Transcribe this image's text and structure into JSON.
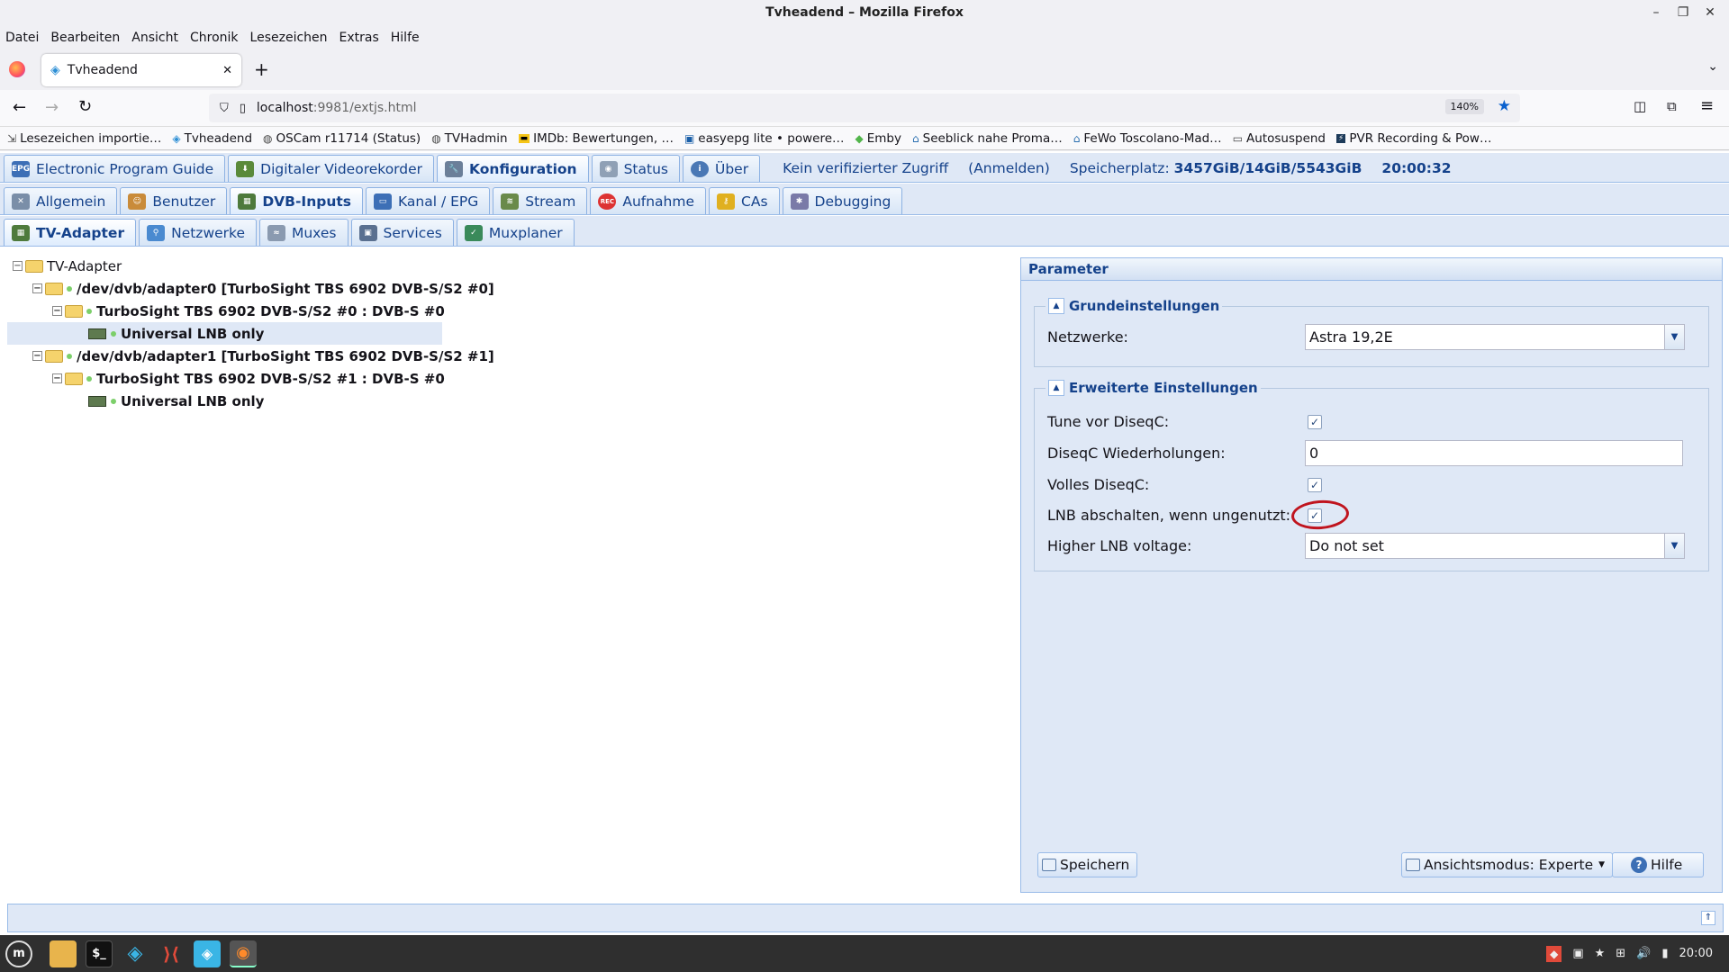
{
  "window": {
    "title": "Tvheadend – Mozilla Firefox"
  },
  "menu": [
    "Datei",
    "Bearbeiten",
    "Ansicht",
    "Chronik",
    "Lesezeichen",
    "Extras",
    "Hilfe"
  ],
  "browser": {
    "tab_title": "Tvheadend",
    "url_host": "localhost",
    "url_rest": ":9981/extjs.html",
    "zoom": "140%"
  },
  "bookmarks": [
    "Lesezeichen importie…",
    "Tvheadend",
    "OSCam r11714 (Status)",
    "TVHadmin",
    "IMDb: Bewertungen, …",
    "easyepg lite • powere…",
    "Emby",
    "Seeblick nahe Proma…",
    "FeWo Toscolano-Mad…",
    "Autosuspend",
    "PVR Recording & Pow…"
  ],
  "top_tabs": [
    {
      "label": "Electronic Program Guide",
      "icon": "epg-icon",
      "color": "#3d6fb6"
    },
    {
      "label": "Digitaler Videorekorder",
      "icon": "download-icon",
      "color": "#5a8a3a"
    },
    {
      "label": "Konfiguration",
      "icon": "wrench-icon",
      "color": "#6b7f99"
    },
    {
      "label": "Status",
      "icon": "eye-icon",
      "color": "#8fa0b5"
    },
    {
      "label": "Über",
      "icon": "info-icon",
      "color": "#4a78b5"
    }
  ],
  "status_info": {
    "access": "Kein verifizierter Zugriff",
    "login": "(Anmelden)",
    "storage_label": "Speicherplatz:",
    "storage_value": "3457GiB/14GiB/5543GiB",
    "time": "20:00:32"
  },
  "config_tabs": [
    {
      "label": "Allgemein",
      "icon": "tools-icon",
      "color": "#7a8ea8"
    },
    {
      "label": "Benutzer",
      "icon": "users-icon",
      "color": "#c98b3a"
    },
    {
      "label": "DVB-Inputs",
      "icon": "dvb-card-icon",
      "color": "#4e7a3c"
    },
    {
      "label": "Kanal / EPG",
      "icon": "tv-icon",
      "color": "#3d6fb6"
    },
    {
      "label": "Stream",
      "icon": "stream-icon",
      "color": "#6a8a4a"
    },
    {
      "label": "Aufnahme",
      "icon": "rec-icon",
      "color": "#d33"
    },
    {
      "label": "CAs",
      "icon": "key-icon",
      "color": "#e0b020"
    },
    {
      "label": "Debugging",
      "icon": "bug-icon",
      "color": "#7a7aa8"
    }
  ],
  "dvb_tabs": [
    {
      "label": "TV-Adapter",
      "icon": "adapter-icon",
      "color": "#4e7a3c"
    },
    {
      "label": "Netzwerke",
      "icon": "antenna-icon",
      "color": "#4a8ad0"
    },
    {
      "label": "Muxes",
      "icon": "mux-icon",
      "color": "#8a9ab0"
    },
    {
      "label": "Services",
      "icon": "services-icon",
      "color": "#5a7090"
    },
    {
      "label": "Muxplaner",
      "icon": "calendar-icon",
      "color": "#3a8a5a"
    }
  ],
  "tree": {
    "root": "TV-Adapter",
    "adapter0": "/dev/dvb/adapter0 [TurboSight TBS 6902 DVB-S/S2 #0]",
    "frontend0": "TurboSight TBS 6902 DVB-S/S2 #0 : DVB-S #0",
    "lnb0": "Universal LNB only",
    "adapter1": "/dev/dvb/adapter1 [TurboSight TBS 6902 DVB-S/S2 #1]",
    "frontend1": "TurboSight TBS 6902 DVB-S/S2 #1 : DVB-S #0",
    "lnb1": "Universal LNB only"
  },
  "params": {
    "title": "Parameter",
    "basic": {
      "legend": "Grundeinstellungen",
      "networks_label": "Netzwerke:",
      "networks_value": "Astra 19,2E"
    },
    "advanced": {
      "legend": "Erweiterte Einstellungen",
      "tune_before_diseqc_label": "Tune vor DiseqC:",
      "tune_before_diseqc": true,
      "diseqc_repeats_label": "DiseqC Wiederholungen:",
      "diseqc_repeats_value": "0",
      "full_diseqc_label": "Volles DiseqC:",
      "full_diseqc": true,
      "lnb_poweroff_label": "LNB abschalten, wenn ungenutzt:",
      "lnb_poweroff": true,
      "higher_voltage_label": "Higher LNB voltage:",
      "higher_voltage_value": "Do not set"
    },
    "buttons": {
      "save": "Speichern",
      "view_mode": "Ansichtsmodus: Experte",
      "help": "Hilfe"
    }
  },
  "annotation": {
    "color": "#c0141e"
  },
  "taskbar": {
    "clock": "20:00"
  }
}
